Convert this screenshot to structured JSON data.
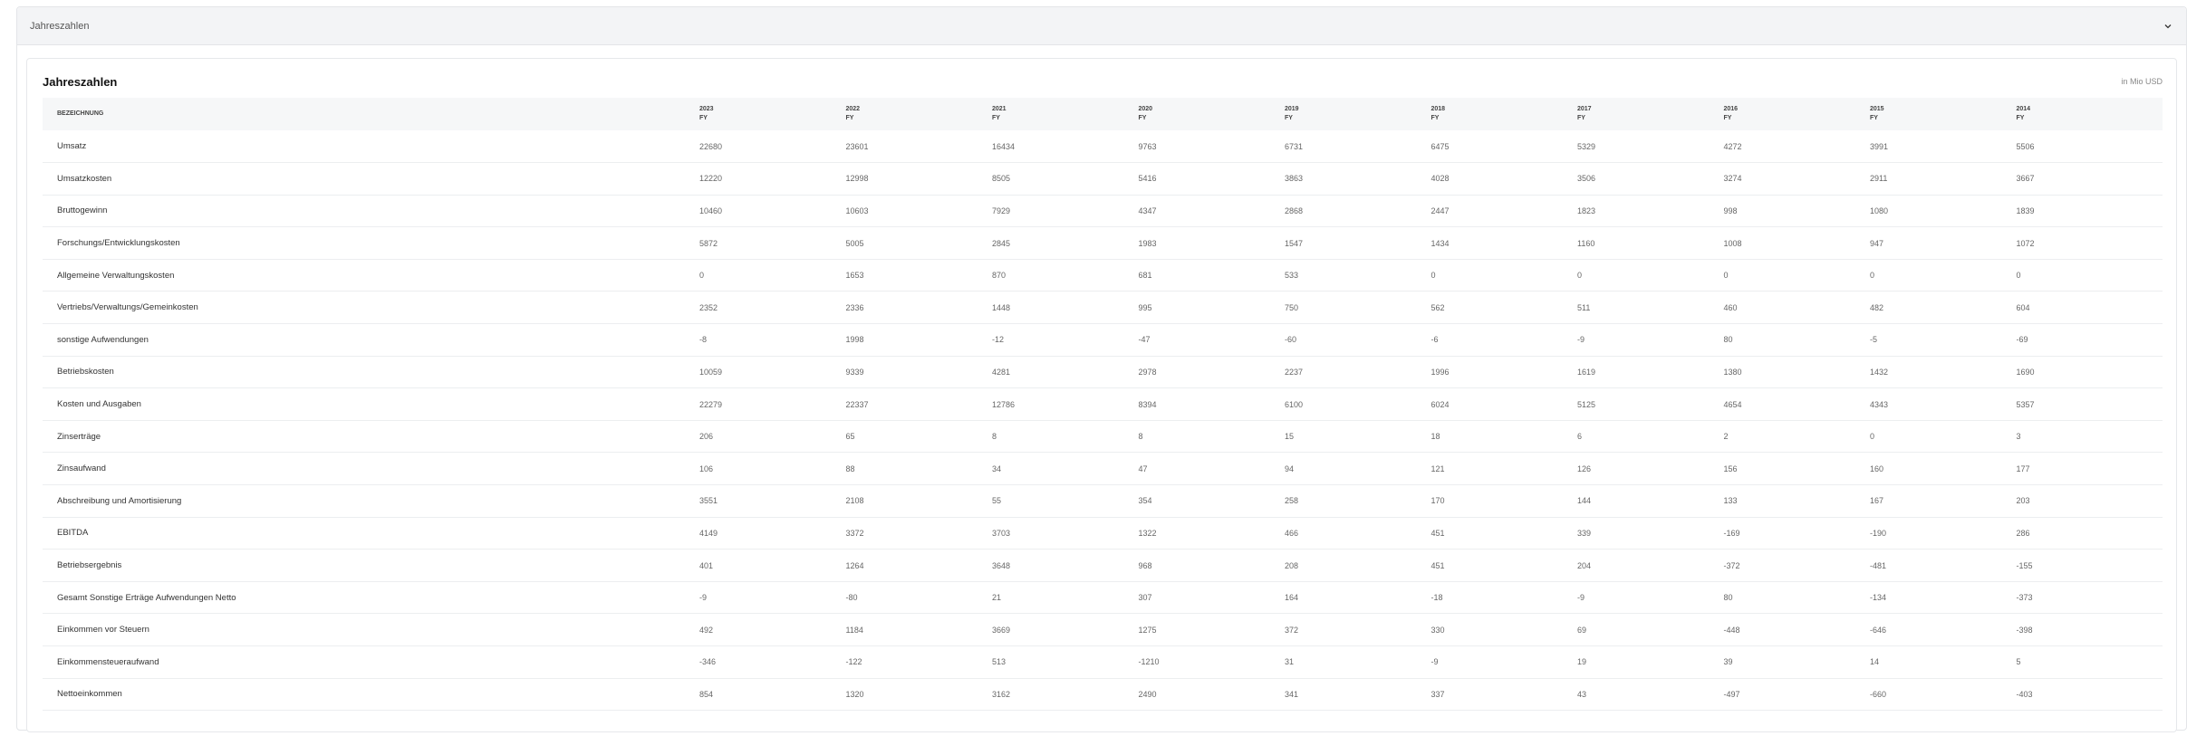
{
  "accordion": {
    "title": "Jahreszahlen"
  },
  "card": {
    "title": "Jahreszahlen",
    "unit": "in Mio USD"
  },
  "table": {
    "name_header": "BEZEICHNUNG",
    "years": [
      "2023",
      "2022",
      "2021",
      "2020",
      "2019",
      "2018",
      "2017",
      "2016",
      "2015",
      "2014"
    ],
    "period": "FY",
    "rows": [
      {
        "label": "Umsatz",
        "values": [
          "22680",
          "23601",
          "16434",
          "9763",
          "6731",
          "6475",
          "5329",
          "4272",
          "3991",
          "5506"
        ]
      },
      {
        "label": "Umsatzkosten",
        "values": [
          "12220",
          "12998",
          "8505",
          "5416",
          "3863",
          "4028",
          "3506",
          "3274",
          "2911",
          "3667"
        ]
      },
      {
        "label": "Bruttogewinn",
        "values": [
          "10460",
          "10603",
          "7929",
          "4347",
          "2868",
          "2447",
          "1823",
          "998",
          "1080",
          "1839"
        ]
      },
      {
        "label": "Forschungs/Entwicklungskosten",
        "values": [
          "5872",
          "5005",
          "2845",
          "1983",
          "1547",
          "1434",
          "1160",
          "1008",
          "947",
          "1072"
        ]
      },
      {
        "label": "Allgemeine Verwaltungskosten",
        "values": [
          "0",
          "1653",
          "870",
          "681",
          "533",
          "0",
          "0",
          "0",
          "0",
          "0"
        ]
      },
      {
        "label": "Vertriebs/Verwaltungs/Gemeinkosten",
        "values": [
          "2352",
          "2336",
          "1448",
          "995",
          "750",
          "562",
          "511",
          "460",
          "482",
          "604"
        ]
      },
      {
        "label": "sonstige Aufwendungen",
        "values": [
          "-8",
          "1998",
          "-12",
          "-47",
          "-60",
          "-6",
          "-9",
          "80",
          "-5",
          "-69"
        ]
      },
      {
        "label": "Betriebskosten",
        "values": [
          "10059",
          "9339",
          "4281",
          "2978",
          "2237",
          "1996",
          "1619",
          "1380",
          "1432",
          "1690"
        ]
      },
      {
        "label": "Kosten und Ausgaben",
        "values": [
          "22279",
          "22337",
          "12786",
          "8394",
          "6100",
          "6024",
          "5125",
          "4654",
          "4343",
          "5357"
        ]
      },
      {
        "label": "Zinserträge",
        "values": [
          "206",
          "65",
          "8",
          "8",
          "15",
          "18",
          "6",
          "2",
          "0",
          "3"
        ]
      },
      {
        "label": "Zinsaufwand",
        "values": [
          "106",
          "88",
          "34",
          "47",
          "94",
          "121",
          "126",
          "156",
          "160",
          "177"
        ]
      },
      {
        "label": "Abschreibung und Amortisierung",
        "values": [
          "3551",
          "2108",
          "55",
          "354",
          "258",
          "170",
          "144",
          "133",
          "167",
          "203"
        ]
      },
      {
        "label": "EBITDA",
        "values": [
          "4149",
          "3372",
          "3703",
          "1322",
          "466",
          "451",
          "339",
          "-169",
          "-190",
          "286"
        ]
      },
      {
        "label": "Betriebsergebnis",
        "values": [
          "401",
          "1264",
          "3648",
          "968",
          "208",
          "451",
          "204",
          "-372",
          "-481",
          "-155"
        ]
      },
      {
        "label": "Gesamt Sonstige Erträge Aufwendungen Netto",
        "values": [
          "-9",
          "-80",
          "21",
          "307",
          "164",
          "-18",
          "-9",
          "80",
          "-134",
          "-373"
        ]
      },
      {
        "label": "Einkommen vor Steuern",
        "values": [
          "492",
          "1184",
          "3669",
          "1275",
          "372",
          "330",
          "69",
          "-448",
          "-646",
          "-398"
        ]
      },
      {
        "label": "Einkommensteueraufwand",
        "values": [
          "-346",
          "-122",
          "513",
          "-1210",
          "31",
          "-9",
          "19",
          "39",
          "14",
          "5"
        ]
      },
      {
        "label": "Nettoeinkommen",
        "values": [
          "854",
          "1320",
          "3162",
          "2490",
          "341",
          "337",
          "43",
          "-497",
          "-660",
          "-403"
        ]
      }
    ]
  }
}
